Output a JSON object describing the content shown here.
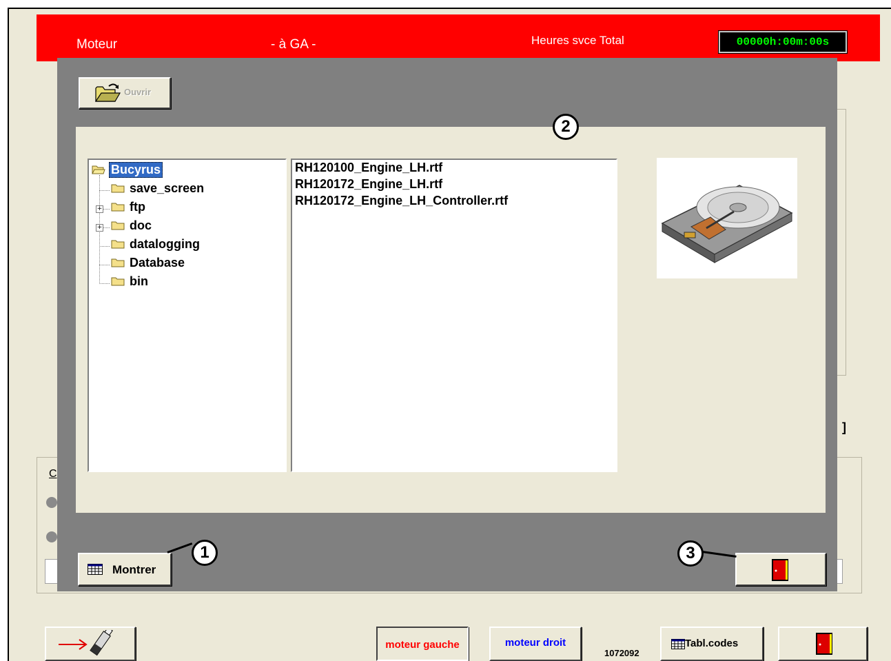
{
  "header": {
    "title": "Moteur",
    "mode": "- à GA -",
    "hours_label": "Heures svce Total",
    "hours_value": "00000h:00m:00s"
  },
  "dialog": {
    "open_button_label": "Ouvrir",
    "tree": [
      {
        "label": "Bucyrus",
        "selected": true,
        "expandable": false
      },
      {
        "label": "save_screen",
        "expandable": false
      },
      {
        "label": "ftp",
        "expandable": true
      },
      {
        "label": "doc",
        "expandable": true
      },
      {
        "label": "datalogging",
        "expandable": false
      },
      {
        "label": "Database",
        "expandable": false
      },
      {
        "label": "bin",
        "expandable": false
      }
    ],
    "files": [
      "RH120100_Engine_LH.rtf",
      "RH120172_Engine_LH.rtf",
      "RH120172_Engine_LH_Controller.rtf"
    ],
    "show_button_label": "Montrer",
    "exit_icon": "exit-door-icon",
    "preview_icon": "hard-drive-icon"
  },
  "callouts": [
    "1",
    "2",
    "3"
  ],
  "background": {
    "group_letter": "C",
    "bracket": "]"
  },
  "bottom_bar": {
    "usb_icon": "usb-export-icon",
    "left_engine_label": "moteur gauche",
    "right_engine_label": "moteur droit",
    "code_number": "1072092",
    "codes_table_label": "Tabl.codes",
    "exit_icon": "exit-door-icon"
  },
  "colors": {
    "header_red": "#ff0000",
    "timer_green": "#00ff00",
    "dialog_gray": "#808080",
    "panel_beige": "#ece9d8",
    "left_engine_text": "#ff0000",
    "right_engine_text": "#0000ff",
    "selection_blue": "#316ac5"
  }
}
